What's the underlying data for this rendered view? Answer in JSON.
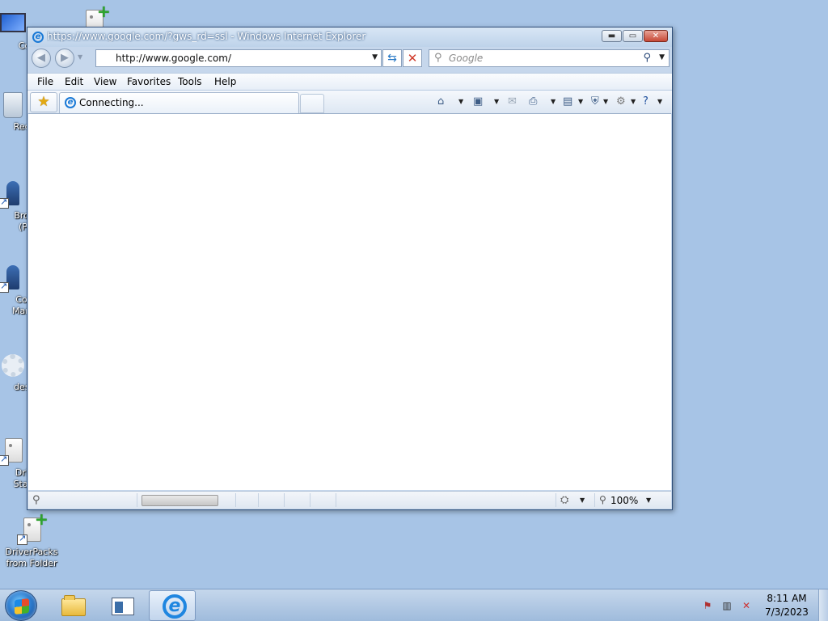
{
  "desktop": {
    "icons": [
      {
        "label": "Co",
        "icon": "computer-icon"
      },
      {
        "label": "",
        "icon": "document-plus-icon"
      },
      {
        "label": "Recy",
        "icon": "recycle-bin-icon"
      },
      {
        "label": "Broa\n(Pl",
        "icon": "shortcut-icon"
      },
      {
        "label": "Con\nMana",
        "icon": "shortcut-icon"
      },
      {
        "label": "desk",
        "icon": "gear-icon"
      },
      {
        "label": "Driv\nStart",
        "icon": "shortcut-icon"
      },
      {
        "label": "DriverPacks from Folder",
        "icon": "document-plus-icon"
      }
    ]
  },
  "window": {
    "title": "https://www.google.com/?gws_rd=ssl - Windows Internet Explorer",
    "controls": {
      "minimize": "▬",
      "maximize": "▭",
      "close": "✕"
    }
  },
  "nav": {
    "back": "◀",
    "forward": "▶",
    "address": "http://www.google.com/",
    "search_placeholder": "Google"
  },
  "menu": [
    "File",
    "Edit",
    "View",
    "Favorites",
    "Tools",
    "Help"
  ],
  "tabs": [
    {
      "label": "Connecting..."
    }
  ],
  "command_bar": [
    "home-icon",
    "feeds-icon",
    "mail-icon",
    "print-icon",
    "page-icon",
    "safety-icon",
    "tools-icon",
    "help-icon"
  ],
  "status": {
    "zoom": "100%"
  },
  "taskbar": {
    "pinned": [
      "folder-icon",
      "window-pane-icon",
      "internet-explorer-icon"
    ],
    "active": "internet-explorer-icon",
    "tray": [
      "tray-flag-icon",
      "network-icon",
      "volume-muted-icon"
    ],
    "time": "8:11 AM",
    "date": "7/3/2023"
  },
  "colors": {
    "desktop": "#a7c4e6",
    "ie_blue": "#1979d6",
    "close_red": "#c74836"
  }
}
